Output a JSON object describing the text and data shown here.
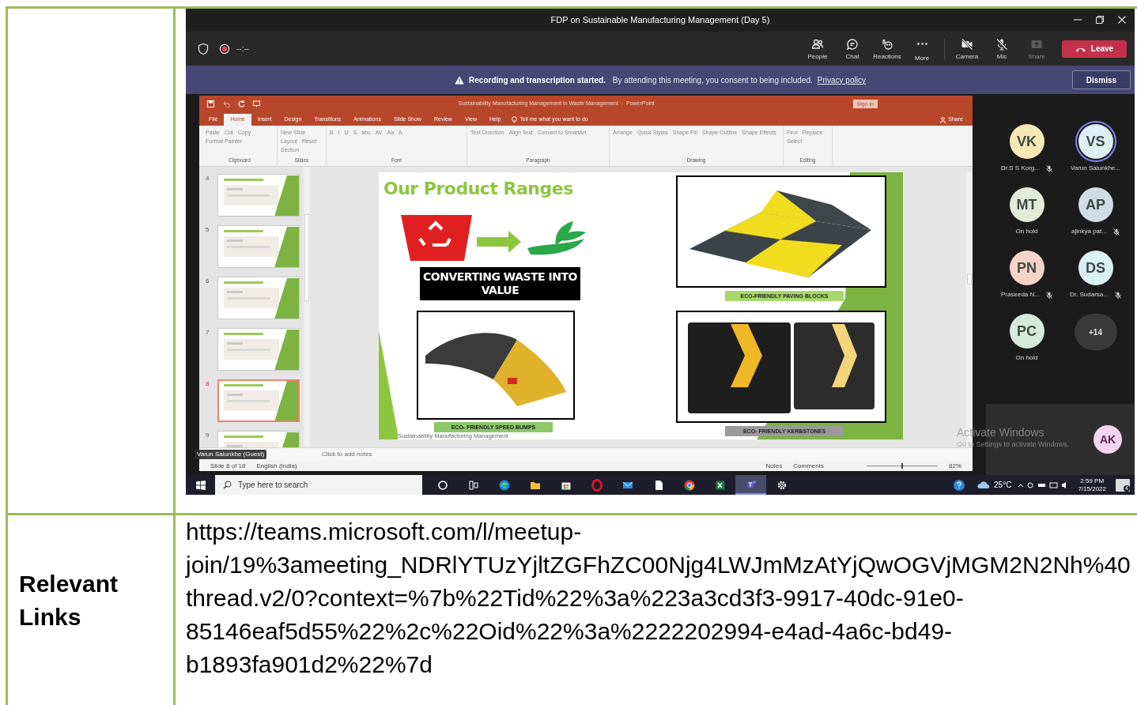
{
  "screenshot": {
    "window_title": "FDP on Sustainable Manufacturing Management (Day 5)",
    "call_timer": "--:--",
    "toolbar": [
      {
        "kind": "people",
        "label": "People",
        "disabled": false
      },
      {
        "kind": "chat",
        "label": "Chat",
        "disabled": false
      },
      {
        "kind": "reactions",
        "label": "Reactions",
        "disabled": false
      },
      {
        "kind": "more",
        "label": "More",
        "disabled": false
      },
      {
        "kind": "camera",
        "label": "Camera",
        "off": true,
        "disabled": false
      },
      {
        "kind": "mic",
        "label": "Mic",
        "off": true,
        "disabled": false
      },
      {
        "kind": "share",
        "label": "Share",
        "disabled": true
      }
    ],
    "leave_button": "Leave",
    "banner": {
      "title": "Recording and transcription started.",
      "text": "By attending this meeting, you consent to being included.",
      "link": "Privacy policy",
      "dismiss": "Dismiss"
    },
    "powerpoint": {
      "title": "Sustainability Manufacturing Management in Waste Management  -  PowerPoint",
      "sign_in": "Sign in",
      "tabs": [
        {
          "label": "File",
          "selected": false
        },
        {
          "label": "Home",
          "selected": true
        },
        {
          "label": "Insert",
          "selected": false
        },
        {
          "label": "Design",
          "selected": false
        },
        {
          "label": "Transitions",
          "selected": false
        },
        {
          "label": "Animations",
          "selected": false
        },
        {
          "label": "Slide Show",
          "selected": false
        },
        {
          "label": "Review",
          "selected": false
        },
        {
          "label": "View",
          "selected": false
        },
        {
          "label": "Help",
          "selected": false
        }
      ],
      "tell_me": "Tell me what you want to do",
      "share": "Share",
      "ribbon_groups": [
        {
          "label": "Clipboard",
          "items": [
            "Paste",
            "Cut",
            "Copy",
            "Format Painter"
          ]
        },
        {
          "label": "Slides",
          "items": [
            "New Slide",
            "Layout",
            "Reset",
            "Section"
          ]
        },
        {
          "label": "Font",
          "items": [
            "B",
            "I",
            "U",
            "S",
            "abc",
            "AV",
            "Aa",
            "A"
          ]
        },
        {
          "label": "Paragraph",
          "items": [
            "Text Direction",
            "Align Text",
            "Convert to SmartArt"
          ]
        },
        {
          "label": "Drawing",
          "items": [
            "Arrange",
            "Quick Styles",
            "Shape Fill",
            "Shape Outline",
            "Shape Effects"
          ]
        },
        {
          "label": "Editing",
          "items": [
            "Find",
            "Replace",
            "Select"
          ]
        }
      ],
      "thumbnails": [
        {
          "number": "4",
          "selected": false
        },
        {
          "number": "5",
          "selected": false
        },
        {
          "number": "6",
          "selected": false
        },
        {
          "number": "7",
          "selected": false
        },
        {
          "number": "8",
          "selected": true
        },
        {
          "number": "9",
          "selected": false
        }
      ],
      "slide": {
        "title": "Our Product Ranges",
        "banner": "CONVERTING WASTE INTO VALUE",
        "footer": "Sustainability Manufacturing Management",
        "products": [
          {
            "kind": "paving",
            "caption": "ECO-FRIENDLY PAVING BLOCKS"
          },
          {
            "kind": "speed_bump",
            "caption": "ECO- FRIENDLY SPEED BUMPS"
          },
          {
            "kind": "kerbstone",
            "caption": "ECO- FRIENDLY KERBSTONES"
          }
        ]
      },
      "notes_placeholder": "Click to add notes",
      "presenter_tag": "Varun Salunkhe (Guest)",
      "status_bar": {
        "slide": "Slide 8 of 18",
        "language": "English (India)",
        "notes": "Notes",
        "comments": "Comments",
        "zoom": "82%"
      }
    },
    "participants": [
      {
        "initials": "VK",
        "name": "Dr.S S Korg...",
        "muted": true,
        "speaking": false,
        "color": "#f7e7b4"
      },
      {
        "initials": "VS",
        "name": "Varun Salunkhe...",
        "muted": false,
        "speaking": true,
        "color": "#dcf0f4"
      },
      {
        "initials": "MT",
        "name": "On hold",
        "muted": false,
        "speaking": false,
        "color": "#e4ead9"
      },
      {
        "initials": "AP",
        "name": "ajinkya pat...",
        "muted": true,
        "speaking": false,
        "color": "#cfdce4"
      },
      {
        "initials": "PN",
        "name": "Praseeda N...",
        "muted": true,
        "speaking": false,
        "color": "#f5d3c8"
      },
      {
        "initials": "DS",
        "name": "Dr. Sudarsa...",
        "muted": true,
        "speaking": false,
        "color": "#d9f0f5"
      },
      {
        "initials": "PC",
        "name": "On hold",
        "muted": false,
        "speaking": false,
        "color": "#d5eadb"
      }
    ],
    "overflow_count": "+14",
    "self_view": {
      "initials": "AK",
      "color": "#f3d4ee"
    },
    "activation_notice": {
      "title": "Activate Windows",
      "text": "Go to Settings to activate Windows."
    },
    "taskbar": {
      "search_placeholder": "Type here to search",
      "apps": [
        {
          "kind": "cortana",
          "active": false
        },
        {
          "kind": "task_view",
          "active": false
        },
        {
          "kind": "edge",
          "active": false
        },
        {
          "kind": "explorer",
          "active": false
        },
        {
          "kind": "store",
          "active": false
        },
        {
          "kind": "opera",
          "active": false
        },
        {
          "kind": "mail",
          "active": false
        },
        {
          "kind": "file",
          "active": false
        },
        {
          "kind": "chrome",
          "active": false
        },
        {
          "kind": "excel",
          "active": false
        },
        {
          "kind": "teams",
          "active": true
        },
        {
          "kind": "settings",
          "active": false
        }
      ],
      "temperature": "25°C",
      "time": "2:59 PM",
      "date": "7/15/2022",
      "notification_count": "4"
    }
  },
  "links_row": {
    "label": "Relevant Links",
    "url": "https://teams.microsoft.com/l/meetup-join/19%3ameeting_NDRlYTUzYjltZGFhZC00Njg4LWJmMzAtYjQwOGVjMGM2N2Nh%40thread.v2/0?context=%7b%22Tid%22%3a%223a3cd3f3-9917-40dc-91e0-85146eaf5d55%22%2c%22Oid%22%3a%2222202994-e4ad-4a6c-bd49-b1893fa901d2%22%7d"
  }
}
